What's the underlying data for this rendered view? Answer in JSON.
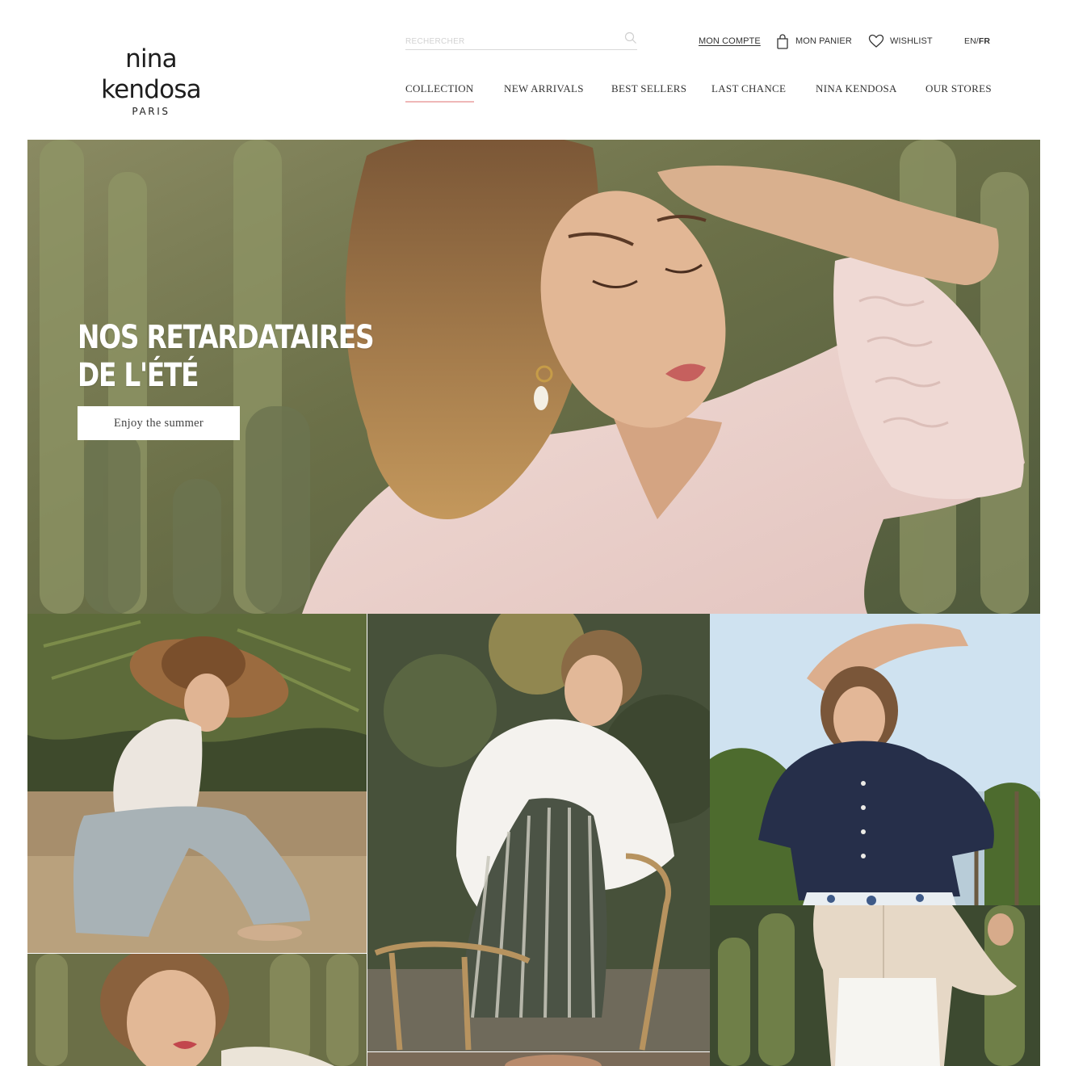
{
  "brand": {
    "name": "nina kendosa",
    "sub": "PARIS"
  },
  "search": {
    "placeholder": "RECHERCHER"
  },
  "utility": {
    "account": "MON COMPTE",
    "cart": "MON PANIER",
    "wishlist": "WISHLIST",
    "lang_en": "EN",
    "lang_sep": "/",
    "lang_fr": "FR"
  },
  "nav": [
    "COLLECTION",
    "NEW ARRIVALS",
    "BEST SELLERS",
    "LAST CHANCE",
    "NINA KENDOSA",
    "OUR STORES"
  ],
  "hero": {
    "title_line1": "NOS RETARDATAIRES",
    "title_line2": "DE L'ÉTÉ",
    "cta": "Enjoy the summer"
  },
  "colors": {
    "nav_active_underline": "#efb8b8",
    "text": "#333333",
    "background": "#ffffff"
  },
  "icons": [
    "search-icon",
    "bag-icon",
    "heart-icon"
  ]
}
